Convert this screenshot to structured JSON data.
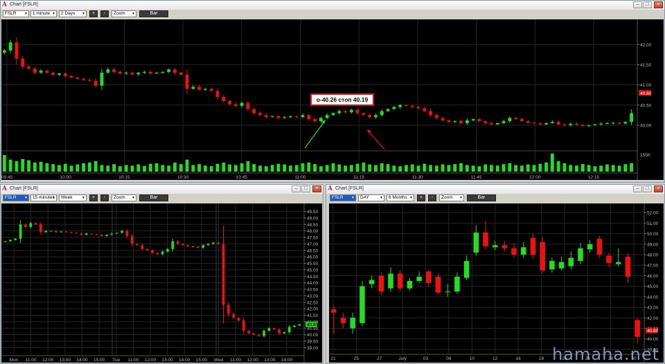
{
  "colors": {
    "up": "#22dd22",
    "down": "#ee1111",
    "volume": "#22dd22",
    "axis_text": "#b8b8b8",
    "grid": "#262626"
  },
  "icons": {
    "logo": "a-logo-icon",
    "minimize": "minimize-icon",
    "maximize": "maximize-icon",
    "close": "close-icon"
  },
  "windows": [
    {
      "title": "Chart [FSLR]",
      "symbol": "FSLR",
      "interval": "1 minute",
      "range": "2 Days",
      "zoom": "Zoom",
      "plus": "+",
      "minus": "-",
      "bar_label": "Bar",
      "annotation": "o-40.26 стоп 40.19",
      "chart_data": {
        "type": "candlestick",
        "ylim": [
          39.45,
          42.45
        ],
        "yticks": [
          "42.00",
          "41.50",
          "41.00",
          "40.50",
          "40.00"
        ],
        "last_price": "40.80",
        "volume_label": "155K",
        "xticks": [
          "09:45",
          "10:00",
          "10:15",
          "10:30",
          "10:45",
          "11:00",
          "11:15",
          "11:30",
          "11:45",
          "12:00",
          "12:15"
        ],
        "closes": [
          41.85,
          42.05,
          41.65,
          41.45,
          41.4,
          41.3,
          41.35,
          41.3,
          41.25,
          41.28,
          41.22,
          41.18,
          41.15,
          41.12,
          41.1,
          40.98,
          41.3,
          41.38,
          41.32,
          41.28,
          41.3,
          41.26,
          41.3,
          41.32,
          41.28,
          41.3,
          41.32,
          41.38,
          41.3,
          41.25,
          40.9,
          40.95,
          40.88,
          40.9,
          40.85,
          40.7,
          40.6,
          40.52,
          40.48,
          40.55,
          40.4,
          40.3,
          40.25,
          40.2,
          40.22,
          40.18,
          40.2,
          40.22,
          40.2,
          40.25,
          40.15,
          40.1,
          40.18,
          40.25,
          40.3,
          40.35,
          40.32,
          40.38,
          40.3,
          40.26,
          40.2,
          40.25,
          40.35,
          40.4,
          40.45,
          40.5,
          40.48,
          40.45,
          40.42,
          40.35,
          40.25,
          40.18,
          40.12,
          40.08,
          40.1,
          40.05,
          40.12,
          40.15,
          40.1,
          40.05,
          40.02,
          40.05,
          40.1,
          40.18,
          40.15,
          40.1,
          40.06,
          40.05,
          40.02,
          40.05,
          40.08,
          40.02,
          40.0,
          40.03,
          40.01,
          39.98,
          40.0,
          40.02,
          40.04,
          40.05,
          40.06,
          40.04,
          40.08,
          40.3
        ],
        "volumes": [
          55,
          40,
          35,
          42,
          38,
          30,
          33,
          28,
          25,
          22,
          26,
          20,
          24,
          28,
          30,
          35,
          22,
          20,
          25,
          18,
          22,
          20,
          24,
          19,
          26,
          28,
          22,
          20,
          30,
          25,
          40,
          22,
          25,
          20,
          18,
          26,
          30,
          24,
          22,
          28,
          35,
          25,
          20,
          18,
          22,
          26,
          24,
          20,
          22,
          28,
          30,
          25,
          18,
          22,
          28,
          24,
          20,
          22,
          26,
          30,
          24,
          22,
          28,
          25,
          20,
          18,
          22,
          24,
          20,
          26,
          22,
          20,
          24,
          22,
          25,
          28,
          22,
          20,
          18,
          24,
          22,
          20,
          25,
          28,
          22,
          20,
          24,
          22,
          26,
          30,
          60,
          35,
          28,
          22,
          20,
          25,
          22,
          18,
          20,
          24,
          22,
          20,
          25,
          28
        ]
      }
    },
    {
      "title": "Chart [FSLR]",
      "symbol": "FSLR",
      "interval": "15 minutes",
      "range": "Week",
      "zoom": "Zoom",
      "plus": "+",
      "minus": "-",
      "bar_label": "Bar",
      "chart_data": {
        "type": "candlestick",
        "ylim": [
          38.7,
          49.9
        ],
        "yticks": [
          "49.50",
          "49.00",
          "48.50",
          "48.00",
          "47.50",
          "47.00",
          "46.50",
          "46.00",
          "45.50",
          "45.00",
          "44.50",
          "44.00",
          "43.50",
          "43.00",
          "42.50",
          "42.00",
          "41.50",
          "41.00",
          "40.50",
          "40.00",
          "39.50",
          "39.00"
        ],
        "last_price": "40.80",
        "xticks": [
          "Mon",
          "11:00",
          "12:00",
          "13:00",
          "14:00",
          "15:00",
          "Tue",
          "11:00",
          "12:00",
          "13:00",
          "14:00",
          "15:00",
          "Wed",
          "11:00",
          "12:00",
          "13:00",
          "14:00"
        ],
        "closes": [
          47.2,
          47.3,
          47.4,
          48.5,
          48.3,
          48.6,
          48.5,
          47.9,
          48.0,
          48.0,
          47.9,
          47.95,
          47.9,
          47.85,
          47.8,
          47.7,
          47.8,
          47.75,
          47.7,
          47.6,
          47.7,
          47.8,
          47.85,
          48.0,
          47.6,
          47.0,
          46.9,
          46.6,
          46.5,
          46.3,
          46.2,
          46.4,
          46.6,
          47.2,
          47.0,
          46.9,
          46.8,
          46.8,
          46.7,
          46.9,
          47.0,
          47.1,
          47.0,
          42.3,
          41.6,
          41.3,
          41.1,
          40.3,
          40.1,
          40.0,
          39.9,
          40.3,
          40.5,
          40.4,
          40.1,
          40.2,
          40.6,
          40.7,
          40.8
        ],
        "sessions": [
          0,
          24,
          43
        ]
      }
    },
    {
      "title": "Chart [FSLR]",
      "symbol": "FSLR",
      "interval": "DAY",
      "range": "6 Months",
      "zoom": "Zoom",
      "plus": "+",
      "minus": "-",
      "bar_label": "Bar",
      "chart_data": {
        "type": "candlestick",
        "ylim": [
          38.8,
          52.6
        ],
        "yticks": [
          "52.00",
          "51.00",
          "50.00",
          "49.00",
          "48.00",
          "47.00",
          "46.00",
          "45.00",
          "44.00",
          "43.00",
          "42.00",
          "41.00",
          "40.00",
          "39.00"
        ],
        "last_price": "40.80",
        "xticks": [
          "21",
          "25",
          "27",
          "July",
          "03",
          "08",
          "10",
          "12",
          "16",
          "18",
          "20",
          "24",
          "26",
          "30"
        ],
        "candles": [
          [
            42.8,
            42.5,
            43.2,
            40.5
          ],
          [
            42.0,
            41.5,
            42.5,
            41.0
          ],
          [
            41.0,
            42.0,
            42.5,
            40.5
          ],
          [
            41.5,
            45.0,
            45.5,
            41.2
          ],
          [
            45.2,
            45.6,
            46.0,
            44.8
          ],
          [
            46.0,
            44.5,
            46.3,
            44.2
          ],
          [
            44.8,
            46.2,
            46.8,
            44.5
          ],
          [
            46.2,
            44.8,
            46.5,
            44.5
          ],
          [
            44.8,
            45.5,
            45.8,
            44.6
          ],
          [
            45.5,
            45.9,
            46.4,
            45.3
          ],
          [
            46.4,
            45.3,
            46.6,
            45.0
          ],
          [
            45.9,
            44.4,
            46.2,
            44.2
          ],
          [
            44.5,
            44.5,
            45.2,
            44.0
          ],
          [
            44.5,
            45.9,
            46.3,
            44.3
          ],
          [
            45.8,
            47.4,
            47.9,
            45.6
          ],
          [
            48.2,
            50.1,
            50.8,
            47.9
          ],
          [
            50.1,
            48.8,
            51.2,
            48.5
          ],
          [
            48.7,
            48.9,
            49.3,
            48.4
          ],
          [
            48.9,
            48.6,
            49.3,
            48.3
          ],
          [
            48.6,
            48.0,
            49.1,
            47.7
          ],
          [
            48.0,
            48.7,
            49.2,
            47.7
          ],
          [
            49.6,
            48.0,
            50.0,
            47.6
          ],
          [
            49.2,
            46.5,
            49.7,
            46.2
          ],
          [
            46.6,
            47.4,
            47.7,
            46.3
          ],
          [
            46.7,
            47.3,
            47.8,
            46.5
          ],
          [
            46.9,
            47.7,
            48.3,
            46.6
          ],
          [
            47.4,
            48.6,
            49.1,
            47.1
          ],
          [
            48.5,
            49.0,
            49.4,
            48.2
          ],
          [
            49.5,
            48.0,
            49.8,
            47.7
          ],
          [
            47.9,
            47.2,
            48.2,
            46.8
          ],
          [
            47.1,
            47.3,
            48.6,
            46.9
          ],
          [
            47.8,
            45.9,
            48.1,
            45.3
          ],
          [
            41.8,
            40.2,
            42.0,
            39.6
          ]
        ]
      }
    }
  ],
  "watermark": "hamaha.net"
}
